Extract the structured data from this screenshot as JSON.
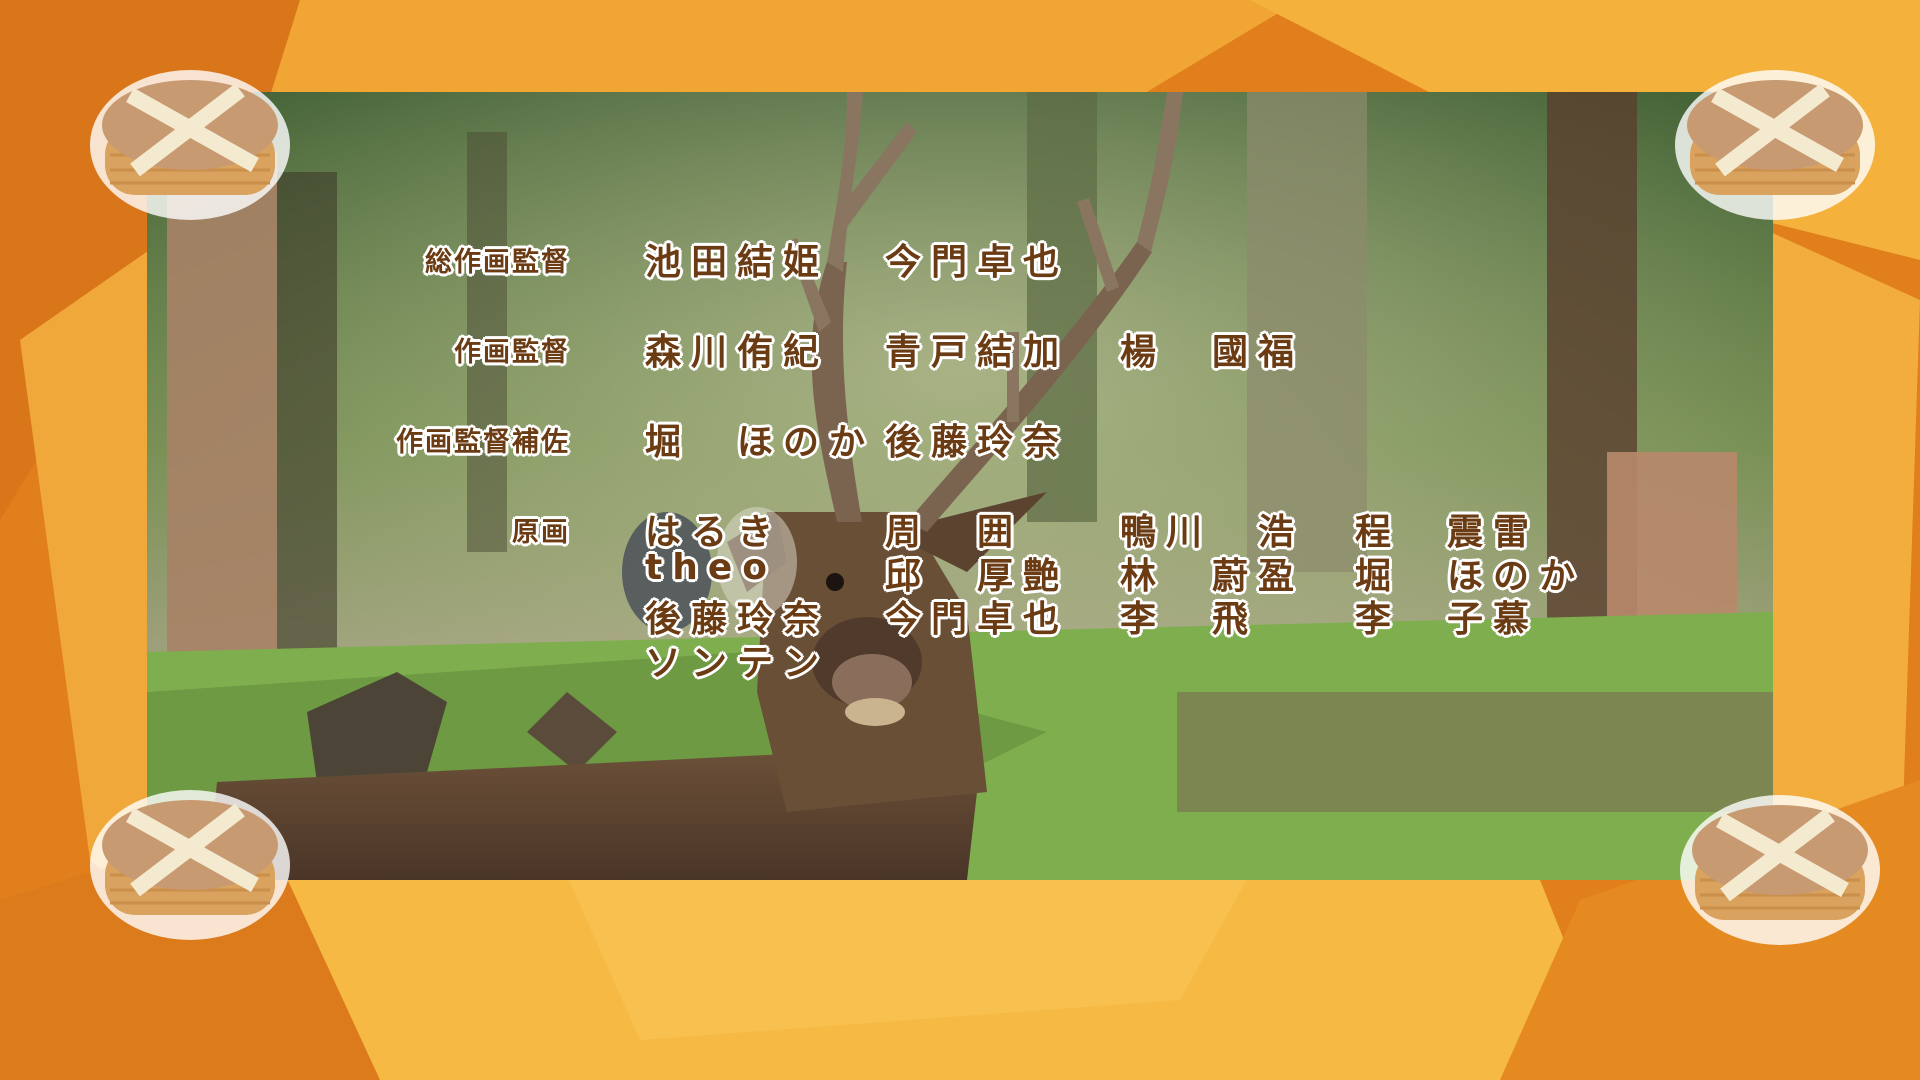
{
  "credits": [
    {
      "role": "総作画監督",
      "names": [
        "池田結姫",
        "今門卓也"
      ]
    },
    {
      "role": "作画監督",
      "names": [
        "森川侑紀",
        "青戸結加",
        "楊　國福"
      ]
    },
    {
      "role": "作画監督補佐",
      "names": [
        "堀　ほのか",
        "後藤玲奈"
      ]
    },
    {
      "role": "原画",
      "names": [
        "はるき",
        "周　囲",
        "鴨川　浩",
        "程　震雷",
        "theo",
        "邱　厚艶",
        "林　蔚盈",
        "堀　ほのか",
        "後藤玲奈",
        "今門卓也",
        "李　飛",
        "李　子慕",
        "ソンテン"
      ]
    }
  ],
  "icons": {
    "corner_decoration": "layered-pancake-cake-icon"
  },
  "colors": {
    "frame_orange": "#e6891f",
    "frame_light": "#f4b23d",
    "text": "#6b3c14",
    "outline": "#ffffff"
  }
}
